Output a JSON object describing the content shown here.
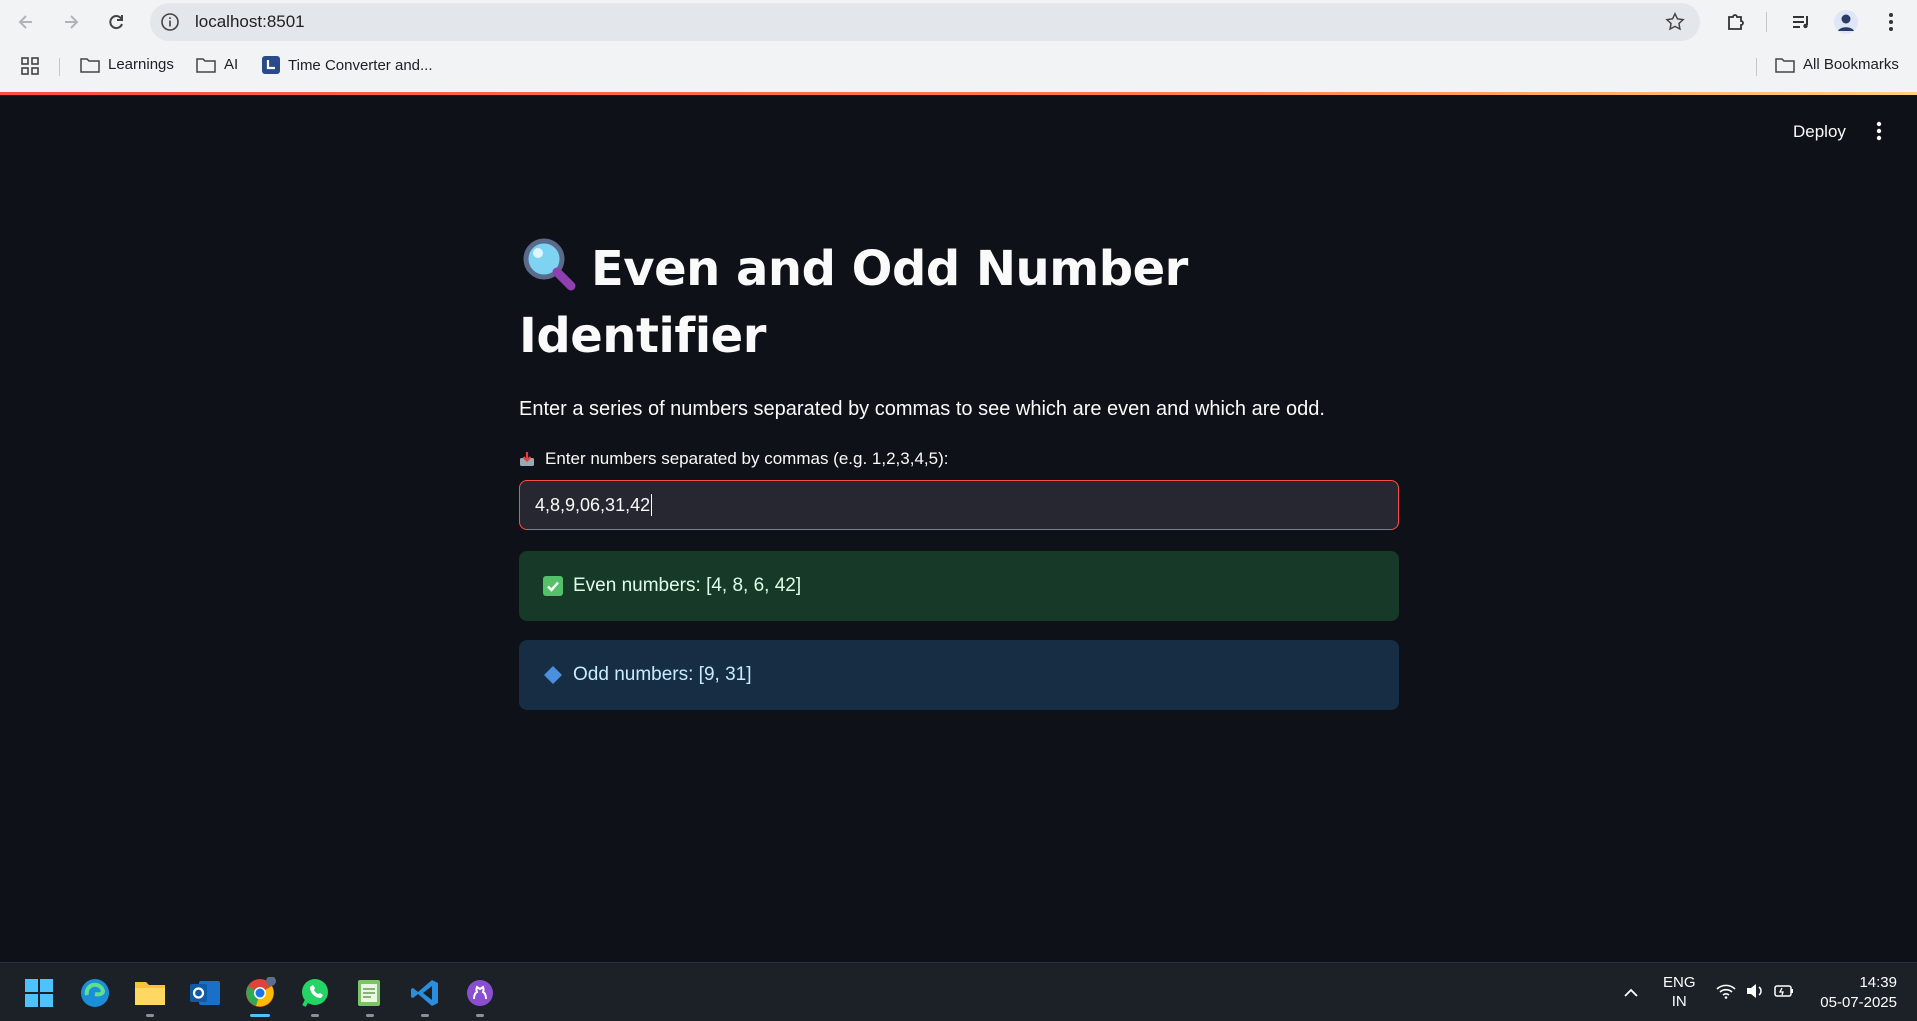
{
  "browser": {
    "url": "localhost:8501",
    "bookmarks": [
      "Learnings",
      "AI",
      "Time Converter and..."
    ],
    "all_bookmarks": "All Bookmarks"
  },
  "app": {
    "deploy_label": "Deploy",
    "title_line1": "Even and Odd Number",
    "title_line2": "Identifier",
    "title_icon": "magnifier-emoji",
    "description": "Enter a series of numbers separated by commas to see which are even and which are odd.",
    "input_label": "Enter numbers separated by commas (e.g. 1,2,3,4,5):",
    "input_value": "4,8,9,06,31,42",
    "even_result": "Even numbers: [4, 8, 6, 42]",
    "odd_result": "Odd numbers: [9, 31]",
    "colors": {
      "background": "#0e1117",
      "accent": "#ff4b4b",
      "success_bg": "#173928",
      "info_bg": "#172d43"
    }
  },
  "taskbar": {
    "apps": [
      "windows-start",
      "edge",
      "file-explorer",
      "outlook",
      "chrome",
      "whatsapp",
      "notepad-app",
      "vscode",
      "github-desktop"
    ],
    "language_line1": "ENG",
    "language_line2": "IN",
    "time": "14:39",
    "date": "05-07-2025"
  }
}
